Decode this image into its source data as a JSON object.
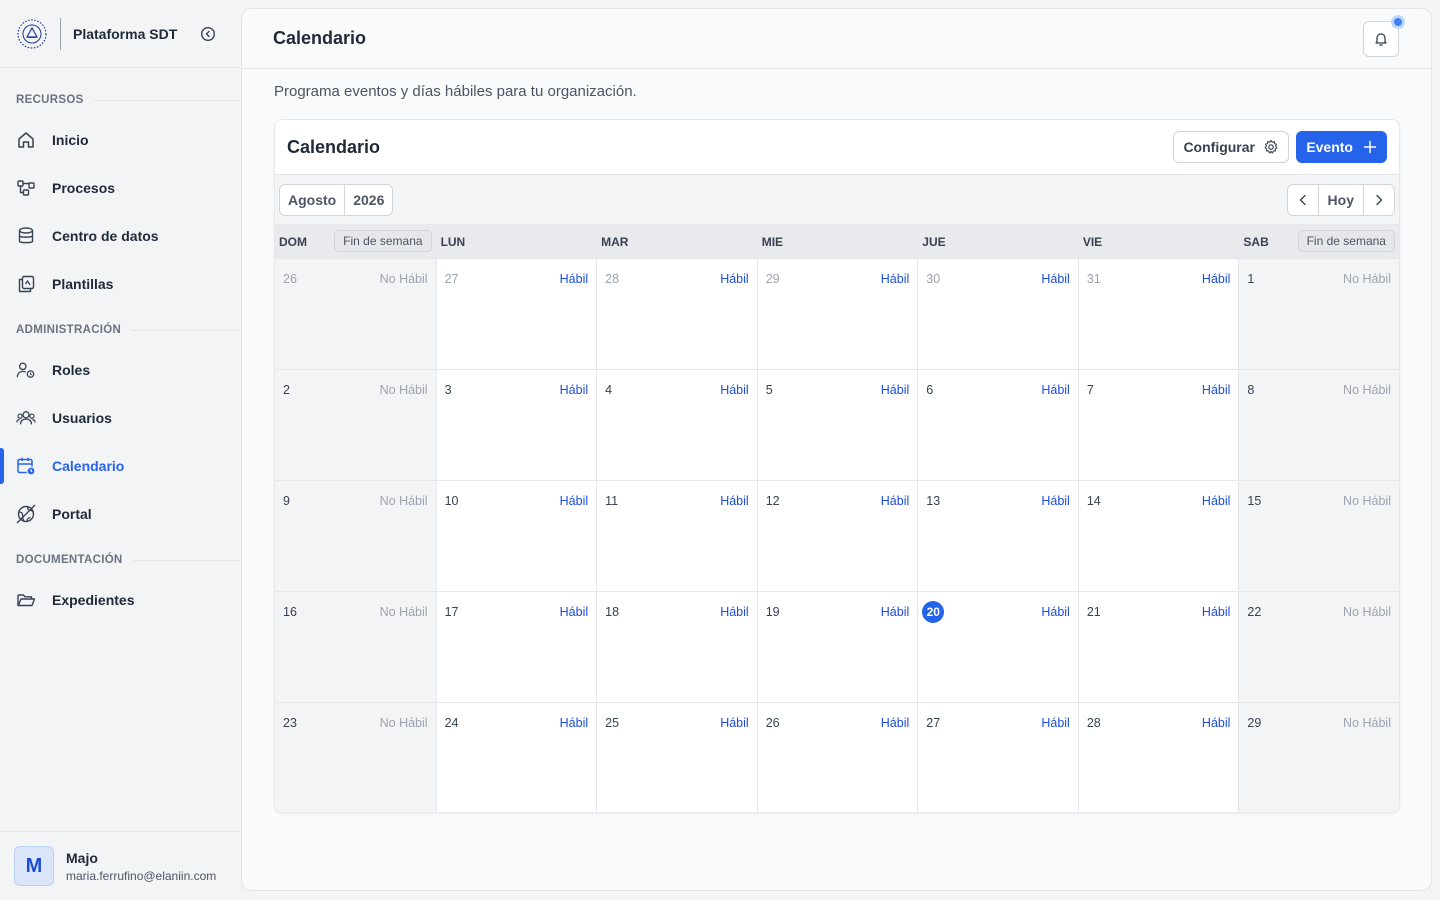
{
  "brand": {
    "name": "Plataforma SDT"
  },
  "sidebar": {
    "sections": [
      {
        "label": "RECURSOS",
        "items": [
          {
            "label": "Inicio",
            "icon": "home-icon"
          },
          {
            "label": "Procesos",
            "icon": "workflow-icon"
          },
          {
            "label": "Centro de datos",
            "icon": "database-icon"
          },
          {
            "label": "Plantillas",
            "icon": "templates-icon"
          }
        ]
      },
      {
        "label": "ADMINISTRACIÓN",
        "items": [
          {
            "label": "Roles",
            "icon": "user-role-icon"
          },
          {
            "label": "Usuarios",
            "icon": "users-icon"
          },
          {
            "label": "Calendario",
            "icon": "calendar-clock-icon",
            "active": true
          },
          {
            "label": "Portal",
            "icon": "globe-icon"
          }
        ]
      },
      {
        "label": "DOCUMENTACIÓN",
        "items": [
          {
            "label": "Expedientes",
            "icon": "folder-open-icon"
          }
        ]
      }
    ]
  },
  "user": {
    "initial": "M",
    "name": "Majo",
    "email": "maria.ferrufino@elaniin.com"
  },
  "header": {
    "title": "Calendario"
  },
  "page": {
    "subtitle": "Programa eventos y días hábiles para tu organización."
  },
  "calendar": {
    "title": "Calendario",
    "configure_label": "Configurar",
    "event_label": "Evento",
    "month": "Agosto",
    "year": "2026",
    "today_label": "Hoy",
    "weekend_badge": "Fin de semana",
    "status_labels": {
      "habil": "Hábil",
      "nohabil": "No Hábil"
    },
    "weekdays": [
      "DOM",
      "LUN",
      "MAR",
      "MIE",
      "JUE",
      "VIE",
      "SAB"
    ],
    "weeks": [
      [
        "26",
        "27",
        "28",
        "29",
        "30",
        "31",
        "1"
      ],
      [
        "2",
        "3",
        "4",
        "5",
        "6",
        "7",
        "8"
      ],
      [
        "9",
        "10",
        "11",
        "12",
        "13",
        "14",
        "15"
      ],
      [
        "16",
        "17",
        "18",
        "19",
        "20",
        "21",
        "22"
      ],
      [
        "23",
        "24",
        "25",
        "26",
        "27",
        "28",
        "29"
      ]
    ],
    "outside_days": [
      [
        0,
        0
      ],
      [
        0,
        1
      ],
      [
        0,
        2
      ],
      [
        0,
        3
      ],
      [
        0,
        4
      ],
      [
        0,
        5
      ]
    ],
    "today": [
      3,
      4
    ]
  },
  "colors": {
    "accent": "#2563eb",
    "habil": "#1d4ed8",
    "nohabil": "#9ca3af"
  }
}
